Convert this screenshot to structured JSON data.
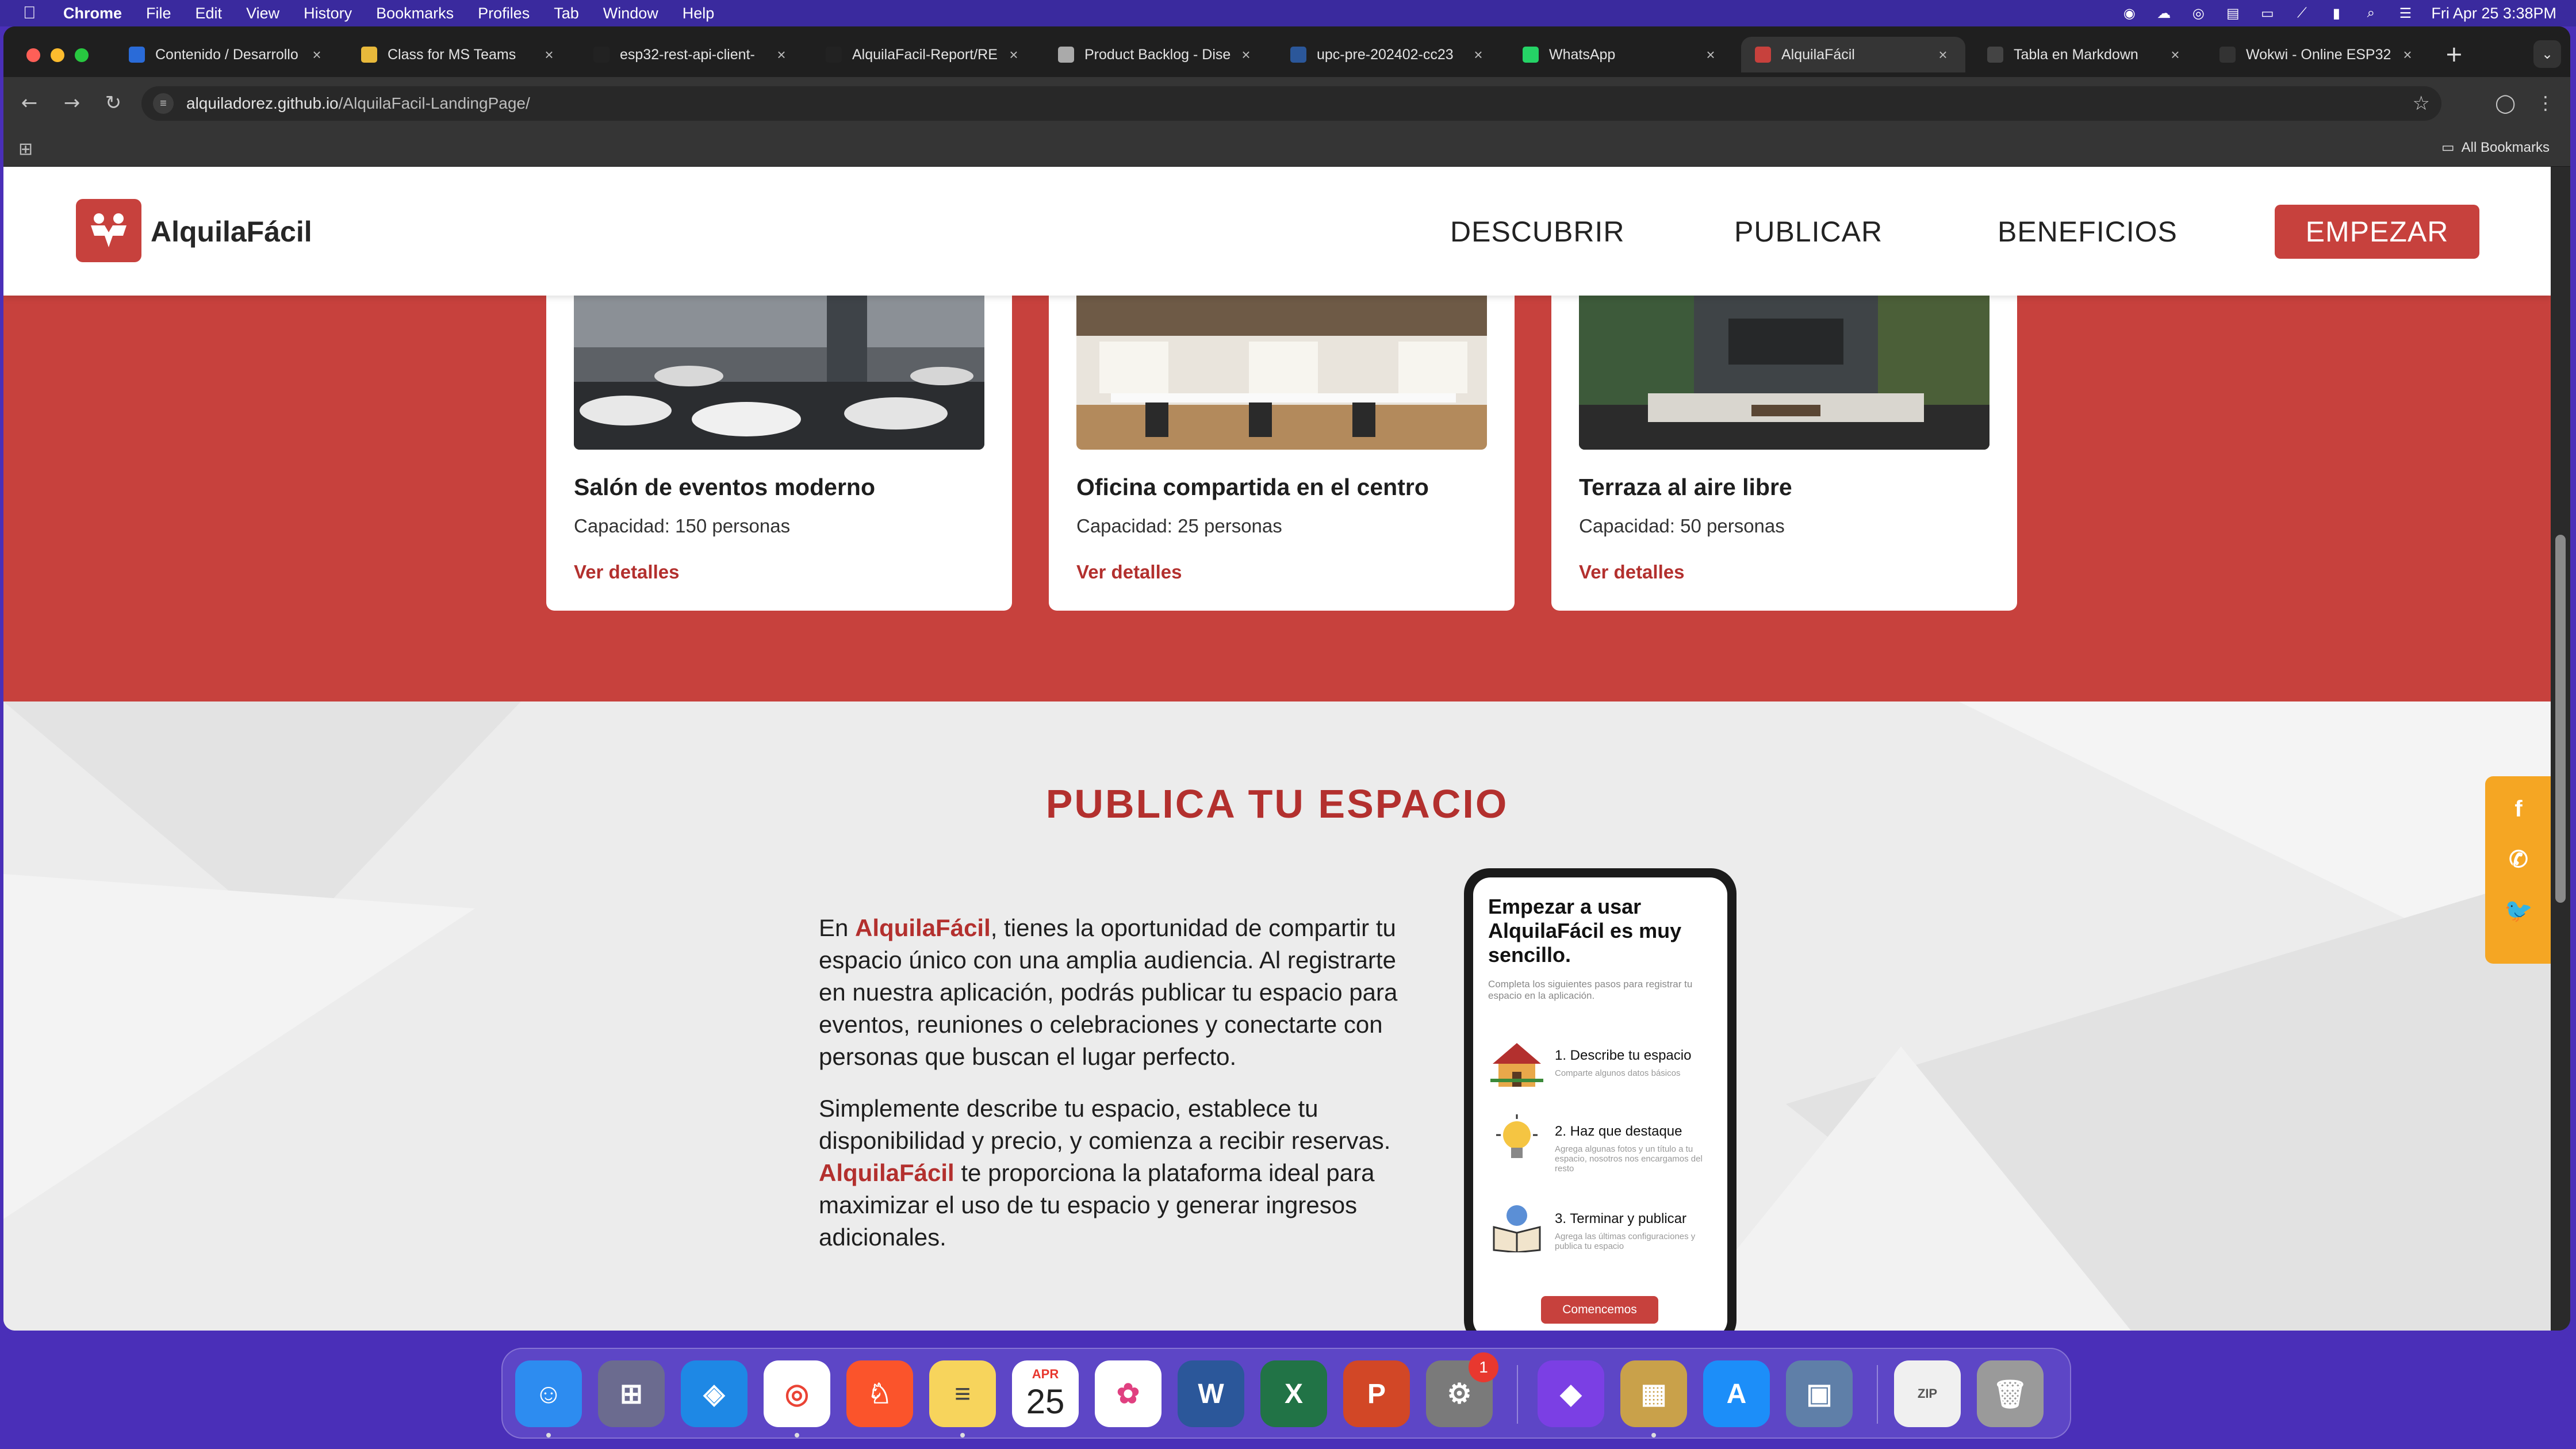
{
  "menubar": {
    "app": "Chrome",
    "items": [
      "File",
      "Edit",
      "View",
      "History",
      "Bookmarks",
      "Profiles",
      "Tab",
      "Window",
      "Help"
    ],
    "clock": "Fri Apr 25  3:38PM"
  },
  "tabs": [
    {
      "title": "Contenido / Desarrollo",
      "icon": "a-letter-icon",
      "color": "#2a6bd8"
    },
    {
      "title": "Class for MS Teams",
      "icon": "grid-icon",
      "color": "#e8b93b"
    },
    {
      "title": "esp32-rest-api-client-",
      "icon": "github-icon",
      "color": "#222222"
    },
    {
      "title": "AlquilaFacil-Report/RE",
      "icon": "github-icon",
      "color": "#222222"
    },
    {
      "title": "Product Backlog - Dise",
      "icon": "azure-icon",
      "color": "#aaaaaa"
    },
    {
      "title": "upc-pre-202402-cc23",
      "icon": "word-icon",
      "color": "#2b579a"
    },
    {
      "title": "WhatsApp",
      "icon": "whatsapp-icon",
      "color": "#25d366"
    },
    {
      "title": "AlquilaFácil",
      "icon": "alquilafacil-icon",
      "color": "#c7413d",
      "active": true
    },
    {
      "title": "Tabla en Markdown",
      "icon": "chatgpt-icon",
      "color": "#444444"
    },
    {
      "title": "Wokwi - Online ESP32",
      "icon": "wokwi-icon",
      "color": "#333333"
    }
  ],
  "address": {
    "host": "alquiladorez.github.io",
    "path": "/AlquilaFacil-LandingPage/"
  },
  "bookmarks": {
    "all": "All Bookmarks"
  },
  "site": {
    "brand": "AlquilaFácil",
    "nav": [
      "DESCUBRIR",
      "PUBLICAR",
      "BENEFICIOS"
    ],
    "cta": "EMPEZAR",
    "brand_color": "#c7413d"
  },
  "cards": [
    {
      "title": "Salón de eventos moderno",
      "capacity": "Capacidad: 150 personas",
      "link": "Ver detalles"
    },
    {
      "title": "Oficina compartida en el centro",
      "capacity": "Capacidad: 25 personas",
      "link": "Ver detalles"
    },
    {
      "title": "Terraza al aire libre",
      "capacity": "Capacidad: 50 personas",
      "link": "Ver detalles"
    }
  ],
  "publish": {
    "heading": "PUBLICA TU ESPACIO",
    "p1_pre": "En ",
    "p1_brand": "AlquilaFácil",
    "p1_post": ", tienes la oportunidad de compartir tu espacio único con una amplia audiencia. Al registrarte en nuestra aplicación, podrás publicar tu espacio para eventos, reuniones o celebraciones y conectarte con personas que buscan el lugar perfecto.",
    "p2_pre": "Simplemente describe tu espacio, establece tu disponibilidad y precio, y comienza a recibir reservas. ",
    "p2_brand": "AlquilaFácil",
    "p2_post": " te proporciona la plataforma ideal para maximizar el uso de tu espacio y generar ingresos adicionales."
  },
  "phone": {
    "title": "Empezar a usar AlquilaFácil es muy sencillo.",
    "subtitle": "Completa los siguientes pasos para registrar tu espacio en la aplicación.",
    "steps": [
      {
        "title": "1.  Describe tu espacio",
        "desc": "Comparte algunos datos básicos"
      },
      {
        "title": "2.  Haz que destaque",
        "desc": "Agrega algunas fotos y un título a tu espacio, nosotros nos encargamos del resto"
      },
      {
        "title": "3.  Terminar y publicar",
        "desc": "Agrega las últimas configuraciones y publica tu espacio"
      }
    ],
    "button": "Comencemos"
  },
  "social": [
    "facebook-icon",
    "whatsapp-icon",
    "twitter-icon"
  ],
  "dock": {
    "calendar_month": "APR",
    "calendar_day": "25",
    "settings_badge": "1",
    "zip_label": "ZIP"
  }
}
